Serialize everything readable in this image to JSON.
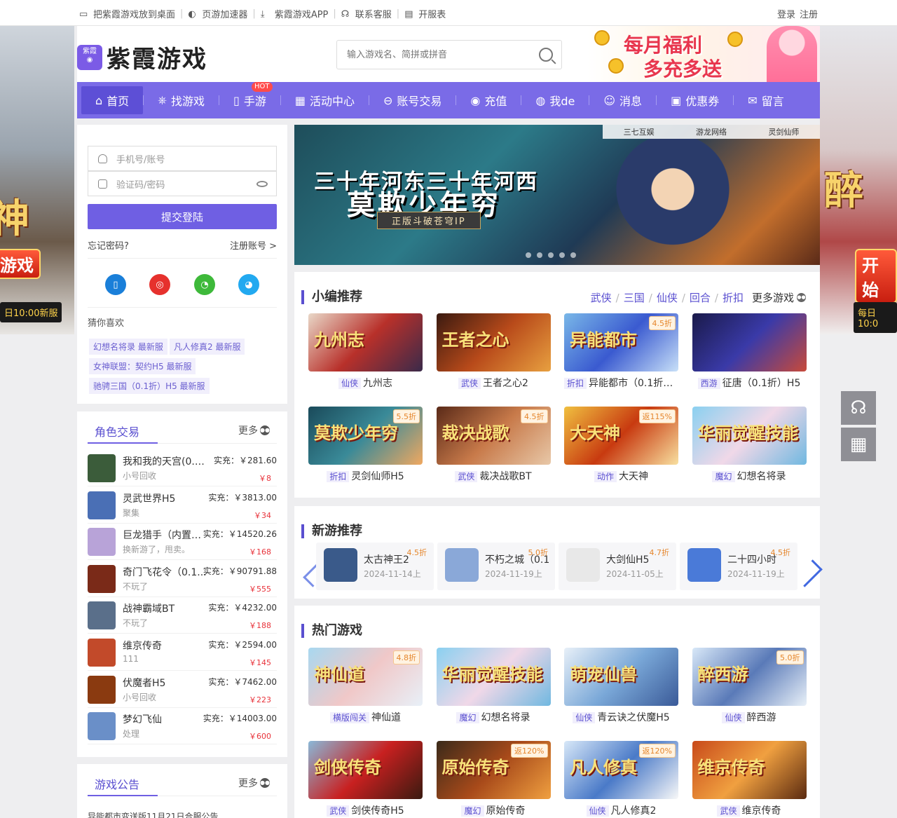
{
  "topbar": {
    "links": [
      {
        "label": "把紫霞游戏放到桌面",
        "icon": "monitor-icon"
      },
      {
        "label": "页游加速器",
        "icon": "accelerator-icon"
      },
      {
        "label": "紫霞游戏APP",
        "icon": "download-icon"
      },
      {
        "label": "联系客服",
        "icon": "headset-icon"
      },
      {
        "label": "开服表",
        "icon": "list-icon"
      }
    ],
    "login": "登录",
    "register": "注册"
  },
  "side_banners": {
    "left": {
      "big": "神",
      "button": "游戏",
      "new": "日10:00新服"
    },
    "right": {
      "big": "醉",
      "button": "开始",
      "new": "每日10:0"
    }
  },
  "header": {
    "logo_small": "紫霞",
    "logo_text": "紫霞游戏",
    "search_placeholder": "输入游戏名、简拼或拼音",
    "promo_line1": "每月福利",
    "promo_line2": "多充多送"
  },
  "nav": {
    "items": [
      {
        "label": "首页",
        "icon": "home-icon"
      },
      {
        "label": "找游戏",
        "icon": "gamepad-icon"
      },
      {
        "label": "手游",
        "icon": "phone-icon",
        "hot": "HOT"
      },
      {
        "label": "活动中心",
        "icon": "grid-icon"
      },
      {
        "label": "账号交易",
        "icon": "exchange-icon"
      },
      {
        "label": "充值",
        "icon": "coin-icon"
      },
      {
        "label": "我de",
        "icon": "user-icon"
      },
      {
        "label": "消息",
        "icon": "message-icon"
      },
      {
        "label": "优惠券",
        "icon": "coupon-icon"
      },
      {
        "label": "留言",
        "icon": "chat-icon"
      }
    ]
  },
  "login": {
    "account_placeholder": "手机号/账号",
    "password_placeholder": "验证码/密码",
    "submit": "提交登陆",
    "forgot": "忘记密码?",
    "register": "注册账号 >",
    "guess_title": "猜你喜欢",
    "tags": [
      "幻想名将录 最新服",
      "凡人修真2 最新服",
      "女神联盟：契约H5 最新服",
      "驰骋三国（0.1折）H5 最新服"
    ]
  },
  "trade": {
    "title": "角色交易",
    "more": "更多",
    "rows": [
      {
        "name": "我和我的天宫(0.0...",
        "price": "实充：￥281.60",
        "sub": "小号回收",
        "sale": "￥8"
      },
      {
        "name": "灵武世界H5",
        "price": "实充：￥3813.00",
        "sub": "聚集",
        "sale": "￥34"
      },
      {
        "name": "巨龙猎手（内置0...",
        "price": "实充：￥14520.26",
        "sub": "换新游了，甩卖。",
        "sale": "￥168"
      },
      {
        "name": "奇门飞花令（0.1...",
        "price": "实充：￥90791.88",
        "sub": "不玩了",
        "sale": "￥555"
      },
      {
        "name": "战神霸域BT",
        "price": "实充：￥4232.00",
        "sub": "不玩了",
        "sale": "￥188"
      },
      {
        "name": "维京传奇",
        "price": "实充：￥2594.00",
        "sub": "111",
        "sale": "￥145"
      },
      {
        "name": "伏魔者H5",
        "price": "实充：￥7462.00",
        "sub": "小号回收",
        "sale": "￥223"
      },
      {
        "name": "梦幻飞仙",
        "price": "实充：￥14003.00",
        "sub": "处理",
        "sale": "￥600"
      }
    ]
  },
  "notice": {
    "title": "游戏公告",
    "more": "更多",
    "first": "异能都市变送版11月21日合服公告"
  },
  "banner": {
    "brands": [
      "三七互娱",
      "游龙网络",
      "灵剑仙师"
    ],
    "line1": "三十年河东三十年河西",
    "line2": "莫欺少年穷",
    "line3": "正版斗破苍穹IP"
  },
  "recommend": {
    "title": "小编推荐",
    "cats": [
      "武侠",
      "三国",
      "仙侠",
      "回合",
      "折扣"
    ],
    "more": "更多游戏",
    "cards": [
      {
        "tag": "仙侠",
        "name": "九州志",
        "img_text": "九州志",
        "badge": ""
      },
      {
        "tag": "武侠",
        "name": "王者之心2",
        "img_text": "王者之心",
        "badge": ""
      },
      {
        "tag": "折扣",
        "name": "异能都市（0.1折）...",
        "img_text": "异能都市",
        "badge": "4.5折"
      },
      {
        "tag": "西游",
        "name": "征唐（0.1折）H5",
        "img_text": "",
        "badge": ""
      },
      {
        "tag": "折扣",
        "name": "灵剑仙师H5",
        "img_text": "莫欺少年穷",
        "badge": "5.5折"
      },
      {
        "tag": "武侠",
        "name": "裁决战歌BT",
        "img_text": "裁决战歌",
        "badge": "4.5折"
      },
      {
        "tag": "动作",
        "name": "大天神",
        "img_text": "大天神",
        "badge": "返115%"
      },
      {
        "tag": "魔幻",
        "name": "幻想名将录",
        "img_text": "华丽觉醒技能",
        "badge": ""
      }
    ]
  },
  "newgames": {
    "title": "新游推荐",
    "items": [
      {
        "name": "太古神王2",
        "date": "2024-11-14上",
        "disc": "4.5折"
      },
      {
        "name": "不朽之城（0.1",
        "date": "2024-11-19上",
        "disc": "5.0折"
      },
      {
        "name": "大剑仙H5",
        "date": "2024-11-05上",
        "disc": "4.7折"
      },
      {
        "name": "二十四小时",
        "date": "2024-11-19上",
        "disc": "4.5折"
      }
    ]
  },
  "hot": {
    "title": "热门游戏",
    "cards": [
      {
        "tag": "横版闯关",
        "name": "神仙道",
        "img_text": "神仙道",
        "badge": "4.8折"
      },
      {
        "tag": "魔幻",
        "name": "幻想名将录",
        "img_text": "华丽觉醒技能",
        "badge": ""
      },
      {
        "tag": "仙侠",
        "name": "青云诀之伏魔H5",
        "img_text": "萌宠仙兽",
        "badge": ""
      },
      {
        "tag": "仙侠",
        "name": "醉西游",
        "img_text": "醉西游",
        "badge": "5.0折"
      },
      {
        "tag": "武侠",
        "name": "剑侠传奇H5",
        "img_text": "剑侠传奇",
        "badge": ""
      },
      {
        "tag": "魔幻",
        "name": "原始传奇",
        "img_text": "原始传奇",
        "badge": "返120%"
      },
      {
        "tag": "仙侠",
        "name": "凡人修真2",
        "img_text": "凡人修真",
        "badge": "返120%"
      },
      {
        "tag": "武侠",
        "name": "维京传奇",
        "img_text": "维京传奇",
        "badge": ""
      }
    ]
  },
  "colors": {
    "brand": "#7a6be7",
    "accent": "#5a4fd0",
    "price": "#e8323a"
  }
}
